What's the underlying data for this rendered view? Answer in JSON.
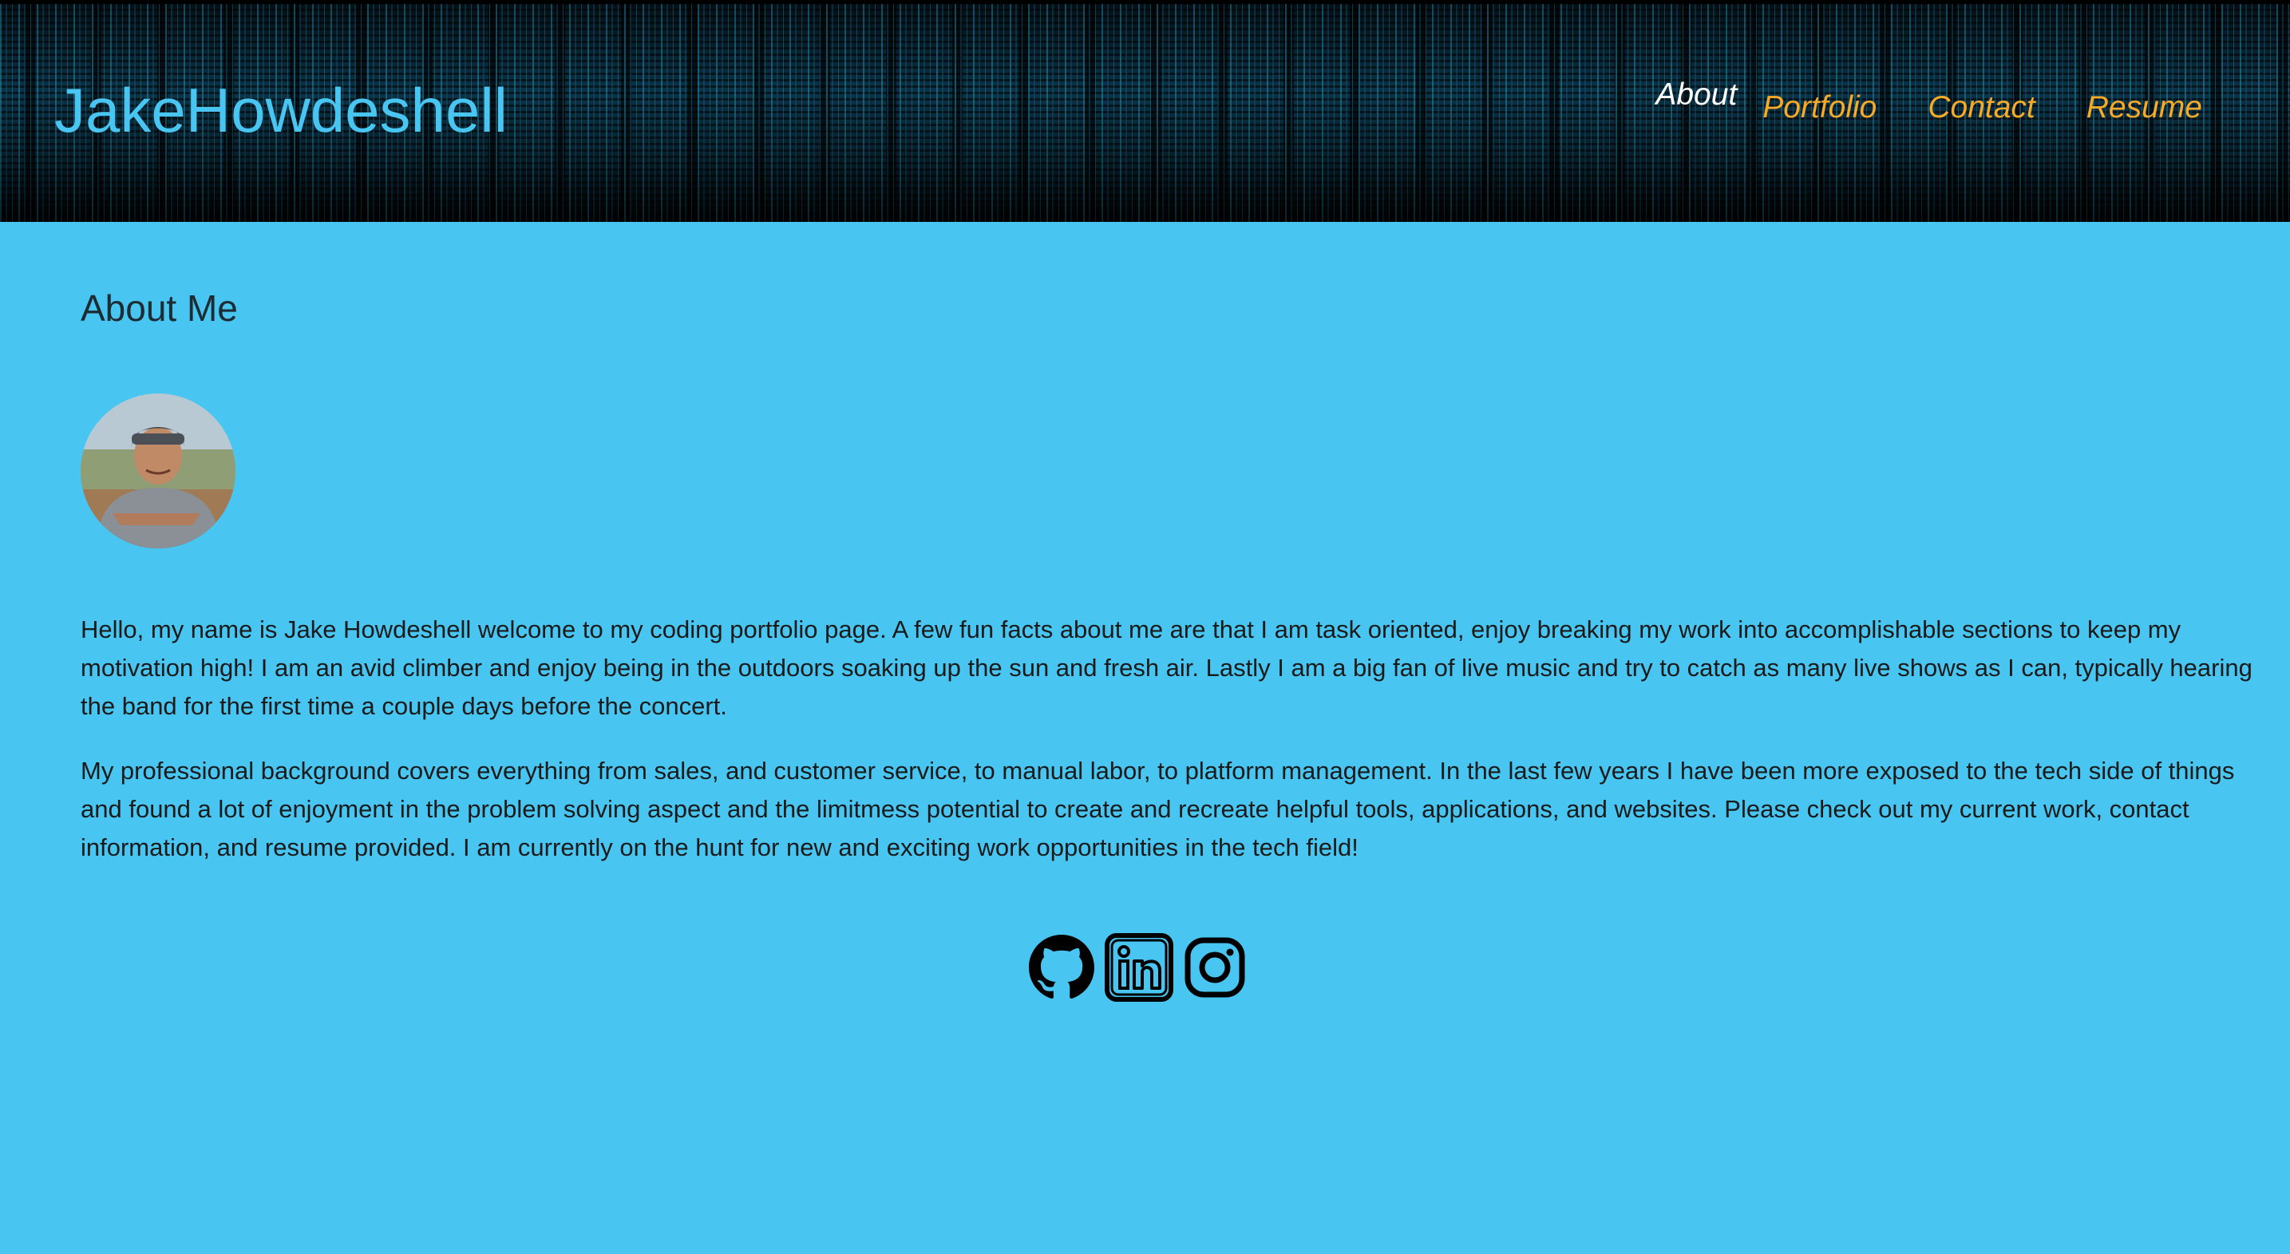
{
  "header": {
    "brand": "JakeHowdeshell",
    "nav": [
      {
        "label": "About",
        "active": true
      },
      {
        "label": "Portfolio",
        "active": false
      },
      {
        "label": "Contact",
        "active": false
      },
      {
        "label": "Resume",
        "active": false
      }
    ]
  },
  "main": {
    "title": "About Me",
    "avatar_icon": "profile-photo",
    "paragraphs": [
      "Hello, my name is Jake Howdeshell welcome to my coding portfolio page. A few fun facts about me are that I am task oriented, enjoy breaking my work into accomplishable sections to keep my motivation high! I am an avid climber and enjoy being in the outdoors soaking up the sun and fresh air. Lastly I am a big fan of live music and try to catch as many live shows as I can, typically hearing the band for the first time a couple days before the concert.",
      "My professional background covers everything from sales, and customer service, to manual labor, to platform management. In the last few years I have been more exposed to the tech side of things and found a lot of enjoyment in the problem solving aspect and the limitmess potential to create and recreate helpful tools, applications, and websites. Please check out my current work, contact information, and resume provided. I am currently on the hunt for new and exciting work opportunities in the tech field!"
    ]
  },
  "social": [
    {
      "icon": "github-icon"
    },
    {
      "icon": "linkedin-icon"
    },
    {
      "icon": "instagram-icon"
    }
  ],
  "colors": {
    "page_background": "#48c5f0",
    "brand_text": "#48c5f0",
    "nav_link": "#f7a928",
    "nav_active": "#ffffff",
    "body_text": "#1a1a1a"
  }
}
